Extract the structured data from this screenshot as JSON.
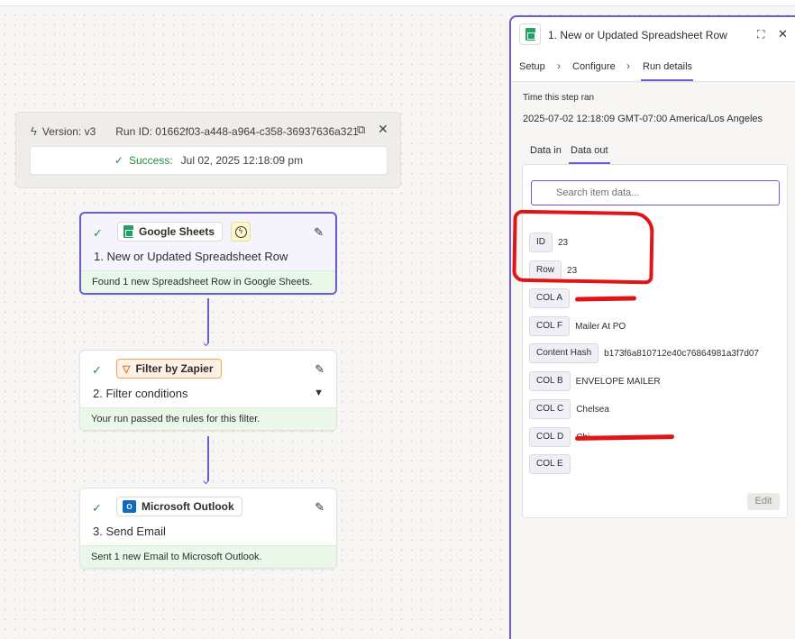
{
  "run": {
    "version": "Version: v3",
    "run_id": "Run ID: 01662f03-a448-a964-c358-36937636a321",
    "status": "Success:",
    "timestamp": "Jul 02, 2025 12:18:09 pm"
  },
  "steps": [
    {
      "app": "Google Sheets",
      "title": "1. New or Updated Spreadsheet Row",
      "result": "Found 1 new Spreadsheet Row in Google Sheets."
    },
    {
      "app": "Filter by Zapier",
      "title": "2. Filter conditions",
      "result": "Your run passed the rules for this filter."
    },
    {
      "app": "Microsoft Outlook",
      "title": "3. Send Email",
      "result": "Sent 1 new Email to Microsoft Outlook."
    }
  ],
  "panel": {
    "title": "1. New or Updated Spreadsheet Row",
    "tabs": [
      "Setup",
      "Configure",
      "Run details"
    ],
    "active_tab": "Run details",
    "time_label": "Time this step ran",
    "time_value": "2025-07-02 12:18:09 GMT-07:00 America/Los Angeles",
    "subtabs": [
      "Data in",
      "Data out"
    ],
    "active_subtab": "Data out",
    "search_placeholder": "Search item data...",
    "fields": [
      {
        "key": "ID",
        "value": "23"
      },
      {
        "key": "Row",
        "value": "23"
      },
      {
        "key": "COL A",
        "value": ""
      },
      {
        "key": "COL F",
        "value": "Mailer At PO"
      },
      {
        "key": "Content Hash",
        "value": "b173f6a810712e40c76864981a3f7d07"
      },
      {
        "key": "COL B",
        "value": "ENVELOPE MAILER"
      },
      {
        "key": "COL C",
        "value": "Chelsea"
      },
      {
        "key": "COL D",
        "value": "Chi"
      },
      {
        "key": "COL E",
        "value": ""
      }
    ],
    "edit_label": "Edit"
  },
  "icons": {
    "bolt": "lightning-icon",
    "external": "external-link-icon",
    "close": "close-icon",
    "check": "check-icon",
    "edit": "pencil-icon",
    "expand": "expand-icon",
    "search": "search-icon"
  },
  "colors": {
    "accent": "#6a5bd6",
    "success": "#1f8f3b",
    "annotation": "#e01616"
  }
}
